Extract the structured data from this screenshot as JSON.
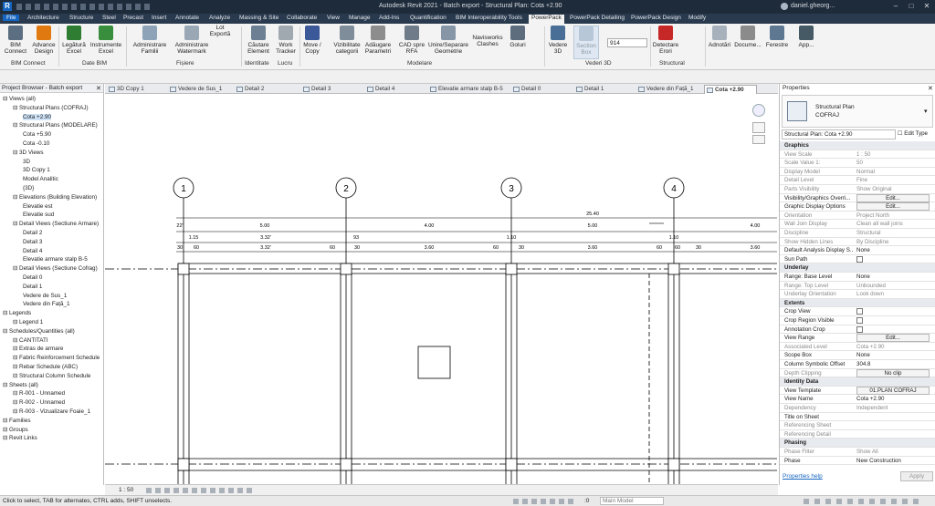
{
  "window": {
    "title": "Autodesk Revit 2021 - Batch export - Structural Plan: Cota +2.90",
    "user": "daniel.gheorg..."
  },
  "menu": [
    "File",
    "Architecture",
    "Structure",
    "Steel",
    "Precast",
    "Insert",
    "Annotate",
    "Analyze",
    "Massing & Site",
    "Collaborate",
    "View",
    "Manage",
    "Add-Ins",
    "Quantification",
    "BIM Interoperability Tools",
    "PowerPack",
    "PowerPack Detailing",
    "PowerPack Design",
    "Modify"
  ],
  "ribbon": {
    "buttons": [
      "BIM Connect",
      "Advance Design",
      "Legătură Excel",
      "Instrumente Excel",
      "Administrare Familii",
      "Administrare Watermark",
      "Lot Exportă",
      "Căutare Element",
      "Work Tracker",
      "Move / Copy",
      "Vizibilitate categorii",
      "Adăugare Parametri",
      "CAD spre RFA",
      "Unire/Separare Geometrie",
      "Navisworks Clashes",
      "Goluri",
      "Vedere 3D",
      "Section Box",
      "914",
      "Detectare Erori",
      "Adnotări",
      "Docume...",
      "Ferestre",
      "App..."
    ],
    "groups": [
      "BIM Connect",
      "Date BIM",
      "Fișiere",
      "Identitate",
      "Lucru",
      "Modelare",
      "Vederi 3D",
      "Structural"
    ]
  },
  "project_browser": {
    "title": "Project Browser - Batch export",
    "items": [
      "Views (all)",
      "Structural Plans (COFRAJ)",
      "Cota +2.90",
      "Structural Plans (MODELARE)",
      "Cota +5.90",
      "Cota -0.10",
      "3D Views",
      "3D",
      "3D Copy 1",
      "Model Analitic",
      "{3D}",
      "Elevations (Building Elevation)",
      "Elevatie est",
      "Elevatie sud",
      "Detail Views (Sectiune Armare)",
      "Detail 2",
      "Detail 3",
      "Detail 4",
      "Elevatie armare stalp B-5",
      "Detail Views (Sectiune Cofrag)",
      "Detail 0",
      "Detail 1",
      "Vedere de Sus_1",
      "Vedere din Față_1",
      "Legends",
      "Legend 1",
      "Schedules/Quantities (all)",
      "CANTITATI",
      "Extras de armare",
      "Fabric Reinforcement Schedule",
      "Rebar Schedule (ABC)",
      "Structural Column Schedule",
      "Sheets (all)",
      "R-001 - Unnamed",
      "R-002 - Unnamed",
      "R-003 - Vizualizare Foaie_1",
      "Families",
      "Groups",
      "Revit Links"
    ]
  },
  "view_tabs": [
    "3D Copy 1",
    "Vedere de Sus_1",
    "Detail 2",
    "Detail 3",
    "Detail 4",
    "Elevatie armare stalp B-5",
    "Detail 0",
    "Detail 1",
    "Vedere din Față_1",
    "Cota +2.90"
  ],
  "drawing": {
    "grid_bubbles": [
      "1",
      "2",
      "3",
      "4"
    ],
    "dims_top": [
      "25.40"
    ],
    "dims_row1": [
      "22'",
      "5.00",
      "4.00",
      "5.00",
      "4.00"
    ],
    "dims_row2": [
      "1.15",
      "3.32'",
      "93",
      "1.10",
      "1.10"
    ],
    "dims_row3": [
      "30",
      "60",
      "3.32'",
      "60",
      "30",
      "3.60",
      "60",
      "30",
      "3.60",
      "60",
      "60",
      "30",
      "3.60"
    ]
  },
  "properties": {
    "title": "Properties",
    "type_name": "Structural Plan",
    "type_sub": "COFRAJ",
    "selector": "Structural Plan: Cota +2.90",
    "edit_type": "Edit Type",
    "rows": [
      {
        "k": "Graphics",
        "sect": true
      },
      {
        "k": "View Scale",
        "v": "1 : 50",
        "gray": true
      },
      {
        "k": "Scale Value    1:",
        "v": "50",
        "gray": true
      },
      {
        "k": "Display Model",
        "v": "Normal",
        "gray": true
      },
      {
        "k": "Detail Level",
        "v": "Fine",
        "gray": true
      },
      {
        "k": "Parts Visibility",
        "v": "Show Original",
        "gray": true
      },
      {
        "k": "Visibility/Graphics Overri...",
        "v": "Edit...",
        "btn": true
      },
      {
        "k": "Graphic Display Options",
        "v": "Edit...",
        "btn": true
      },
      {
        "k": "Orientation",
        "v": "Project North",
        "gray": true
      },
      {
        "k": "Wall Join Display",
        "v": "Clean all wall joins",
        "gray": true
      },
      {
        "k": "Discipline",
        "v": "Structural",
        "gray": true
      },
      {
        "k": "Show Hidden Lines",
        "v": "By Discipline",
        "gray": true
      },
      {
        "k": "Default Analysis Display S...",
        "v": "None"
      },
      {
        "k": "Sun Path",
        "v": "",
        "chk": true
      },
      {
        "k": "Underlay",
        "sect": true
      },
      {
        "k": "Range: Base Level",
        "v": "None"
      },
      {
        "k": "Range: Top Level",
        "v": "Unbounded",
        "gray": true
      },
      {
        "k": "Underlay Orientation",
        "v": "Look down",
        "gray": true
      },
      {
        "k": "Extents",
        "sect": true
      },
      {
        "k": "Crop View",
        "v": "",
        "chk": true
      },
      {
        "k": "Crop Region Visible",
        "v": "",
        "chk": true
      },
      {
        "k": "Annotation Crop",
        "v": "",
        "chk": true
      },
      {
        "k": "View Range",
        "v": "Edit...",
        "btn": true
      },
      {
        "k": "Associated Level",
        "v": "Cota +2.90",
        "gray": true
      },
      {
        "k": "Scope Box",
        "v": "None"
      },
      {
        "k": "Column Symbolic Offset",
        "v": "304.8"
      },
      {
        "k": "Depth Clipping",
        "v": "No clip",
        "btn": true,
        "gray": true
      },
      {
        "k": "Identity Data",
        "sect": true
      },
      {
        "k": "View Template",
        "v": "01.PLAN COFRAJ",
        "btn": true
      },
      {
        "k": "View Name",
        "v": "Cota +2.90"
      },
      {
        "k": "Dependency",
        "v": "Independent",
        "gray": true
      },
      {
        "k": "Title on Sheet",
        "v": ""
      },
      {
        "k": "Referencing Sheet",
        "v": "",
        "gray": true
      },
      {
        "k": "Referencing Detail",
        "v": "",
        "gray": true
      },
      {
        "k": "Phasing",
        "sect": true
      },
      {
        "k": "Phase Filter",
        "v": "Show All",
        "gray": true
      },
      {
        "k": "Phase",
        "v": "New Construction"
      }
    ],
    "help": "Properties help",
    "apply": "Apply"
  },
  "viewbar": {
    "scale": "1 : 50"
  },
  "status": {
    "text": "Click to select, TAB for alternates, CTRL adds, SHIFT unselects.",
    "model": "Main Model",
    "zero": ":0"
  }
}
